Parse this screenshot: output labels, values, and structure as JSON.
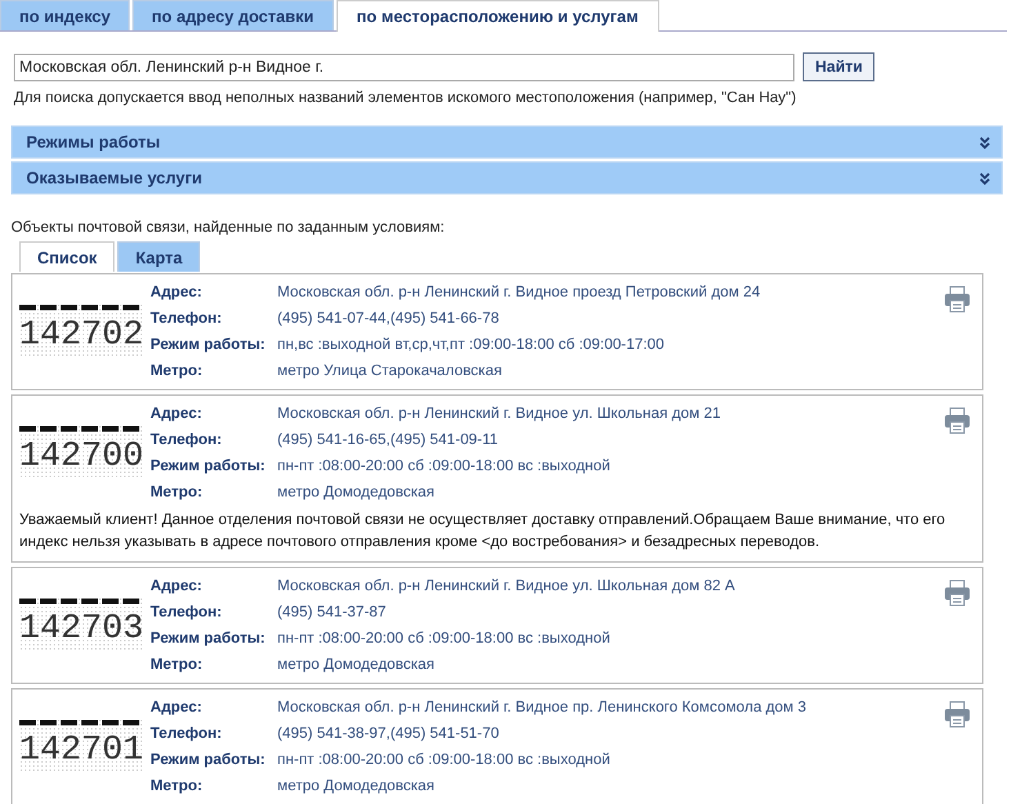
{
  "tabs": [
    {
      "label": "по индексу",
      "selected": false
    },
    {
      "label": "по адресу доставки",
      "selected": false
    },
    {
      "label": "по месторасположению и услугам",
      "selected": true
    }
  ],
  "search": {
    "value": "Московская обл. Ленинский р-н Видное г.",
    "button": "Найти",
    "hint": "Для поиска допускается ввод неполных названий элементов искомого местоположения (например, \"Сан Нау\")"
  },
  "filters": [
    {
      "title": "Режимы работы",
      "expanded": false
    },
    {
      "title": "Оказываемые услуги",
      "expanded": false
    }
  ],
  "results_caption": "Объекты почтовой связи, найденные по заданным условиям:",
  "view_tabs": [
    {
      "label": "Список",
      "selected": true
    },
    {
      "label": "Карта",
      "selected": false
    }
  ],
  "offices": [
    {
      "index": "142702",
      "fields": [
        {
          "label": "Адрес:",
          "value": "Московская обл. р-н Ленинский г. Видное проезд Петровский дом 24"
        },
        {
          "label": "Телефон:",
          "value": "(495) 541-07-44,(495) 541-66-78"
        },
        {
          "label": "Режим работы:",
          "value": "пн,вс :выходной вт,ср,чт,пт :09:00-18:00 сб :09:00-17:00"
        },
        {
          "label": "Метро:",
          "value": "метро Улица Старокачаловская"
        }
      ]
    },
    {
      "index": "142700",
      "fields": [
        {
          "label": "Адрес:",
          "value": "Московская обл. р-н Ленинский г. Видное ул. Школьная дом 21"
        },
        {
          "label": "Телефон:",
          "value": "(495) 541-16-65,(495) 541-09-11"
        },
        {
          "label": "Режим работы:",
          "value": "пн-пт :08:00-20:00 сб :09:00-18:00 вс :выходной"
        },
        {
          "label": "Метро:",
          "value": "метро Домодедовская"
        }
      ],
      "notice": "Уважаемый клиент! Данное отделения почтовой связи не осуществляет доставку отправлений.Обращаем Ваше внимание, что его индекс нельзя указывать в адресе почтового отправления кроме <до востребования> и безадресных переводов."
    },
    {
      "index": "142703",
      "fields": [
        {
          "label": "Адрес:",
          "value": "Московская обл. р-н Ленинский г. Видное ул. Школьная дом 82 А"
        },
        {
          "label": "Телефон:",
          "value": "(495) 541-37-87"
        },
        {
          "label": "Режим работы:",
          "value": "пн-пт :08:00-20:00 сб :09:00-18:00 вс :выходной"
        },
        {
          "label": "Метро:",
          "value": "метро Домодедовская"
        }
      ]
    },
    {
      "index": "142701",
      "fields": [
        {
          "label": "Адрес:",
          "value": "Московская обл. р-н Ленинский г. Видное пр. Ленинского Комсомола дом 3"
        },
        {
          "label": "Телефон:",
          "value": "(495) 541-38-97,(495) 541-51-70"
        },
        {
          "label": "Режим работы:",
          "value": "пн-пт :08:00-20:00 сб :09:00-18:00 вс :выходной"
        },
        {
          "label": "Метро:",
          "value": "метро Домодедовская"
        }
      ]
    }
  ]
}
